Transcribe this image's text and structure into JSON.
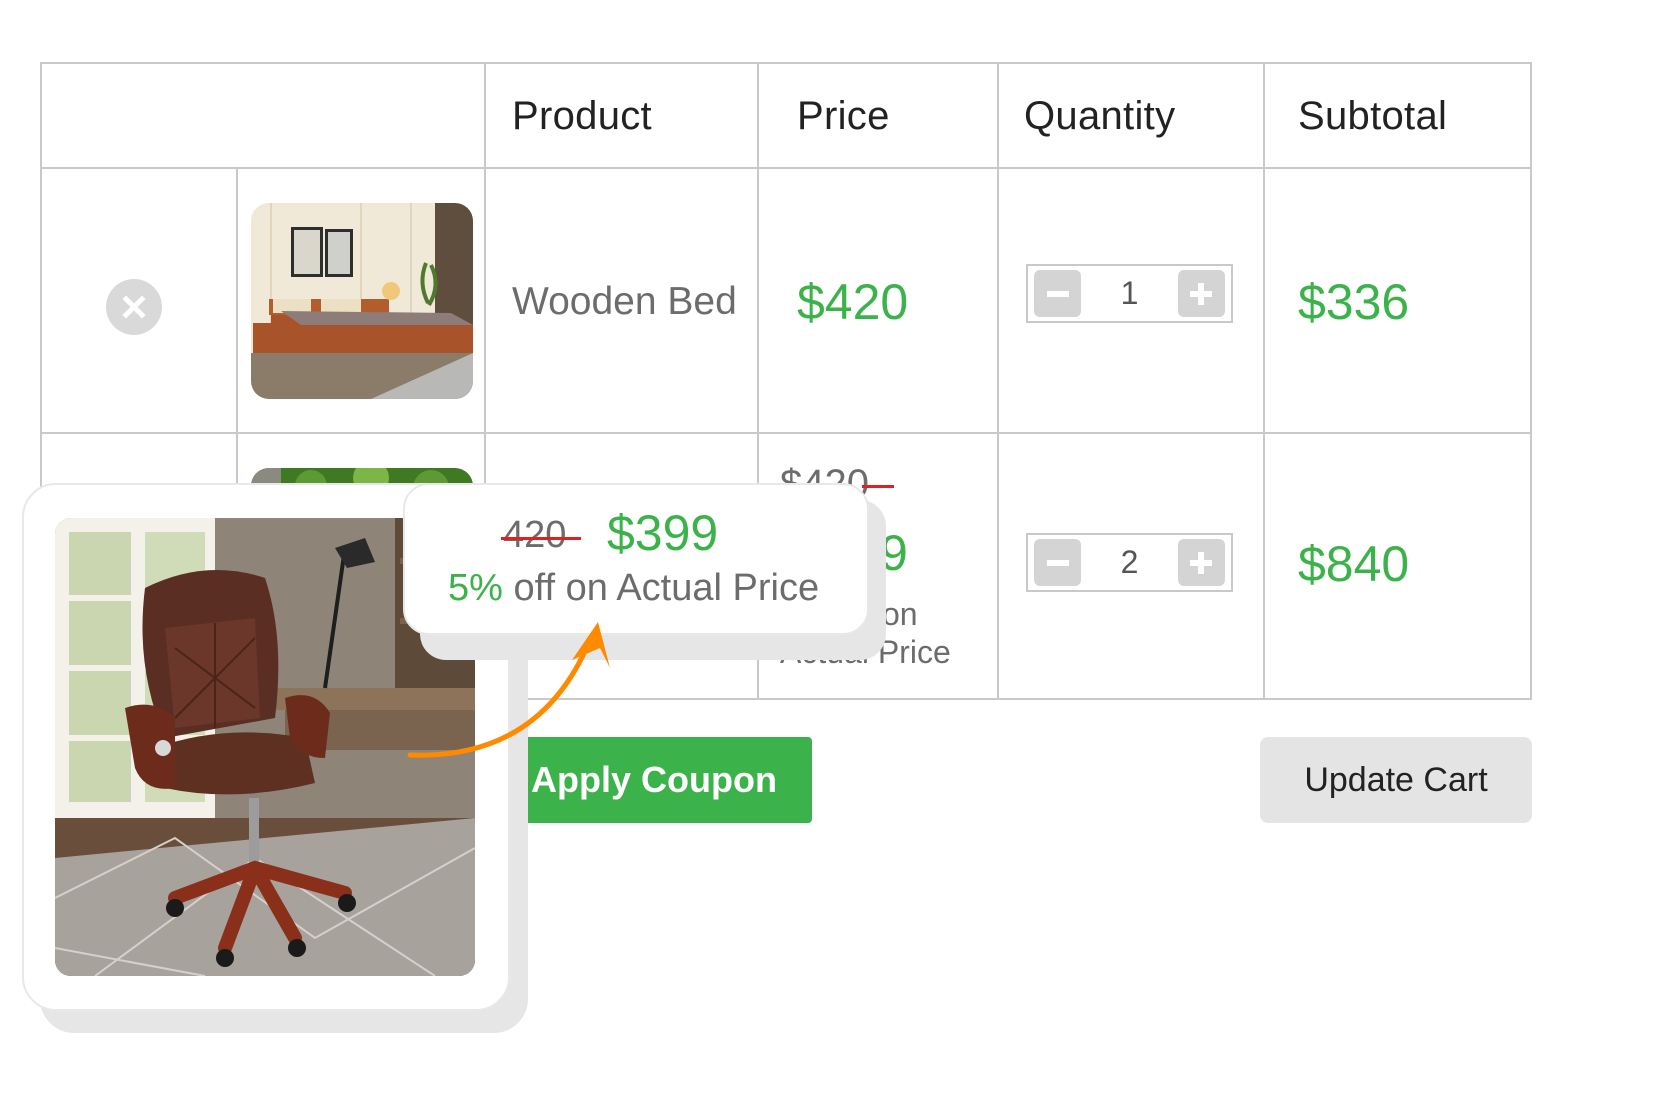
{
  "table": {
    "headers": [
      "",
      "Product",
      "Price",
      "Quantity",
      "Subtotal"
    ],
    "rows": [
      {
        "product": "Wooden Bed",
        "image": "wooden-bed-photo",
        "price": "$420",
        "quantity": "1",
        "subtotal": "$336"
      },
      {
        "product": "",
        "image": "garden-photo",
        "price_old": "$420",
        "price_new_partial": "9",
        "discount_note_partial": "on",
        "discount_note_line2": "Actual Price",
        "quantity": "2",
        "subtotal": "$840"
      }
    ]
  },
  "actions": {
    "apply_coupon": "Apply Coupon",
    "update_cart": "Update Cart"
  },
  "overlay": {
    "image": "leather-office-chair-photo",
    "old_price": "420",
    "new_price": "$399",
    "discount_percent": "5%",
    "discount_text": " off on Actual Price"
  },
  "icons": {
    "remove": "close-icon",
    "decrement": "minus-icon",
    "increment": "plus-icon",
    "callout": "curved-arrow-icon"
  },
  "colors": {
    "accent_green": "#3cb34a",
    "strike_red": "#e02020",
    "arrow_orange": "#ff8a00",
    "border_gray": "#c9c9c9",
    "button_gray": "#e4e4e4"
  }
}
